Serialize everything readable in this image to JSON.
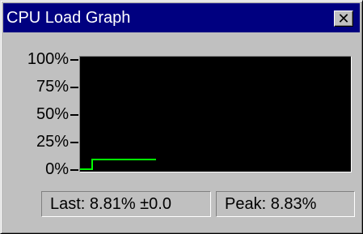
{
  "window": {
    "title": "CPU Load Graph",
    "close_label": "✕"
  },
  "graph": {
    "y_labels": [
      "100%",
      "75%",
      "50%",
      "25%",
      "0%"
    ],
    "line_color": "#00ff00",
    "background_color": "#000000",
    "samples": [
      0,
      0,
      0,
      0,
      0,
      0,
      0,
      0,
      0,
      0,
      0,
      0,
      0,
      0,
      0,
      8.81,
      8.81,
      8.81,
      8.81,
      8.81,
      8.81,
      8.81,
      8.81,
      8.81,
      8.81,
      8.81,
      8.81,
      8.81,
      8.81,
      8.81,
      8.81,
      8.81,
      8.81,
      8.81,
      8.81,
      8.81,
      8.81,
      8.81,
      8.81,
      8.81,
      8.81,
      8.81,
      8.81,
      8.81,
      8.81,
      8.81,
      8.81,
      8.81,
      8.81,
      8.81,
      8.81,
      8.81,
      8.81,
      8.81,
      8.81,
      8.81,
      8.81,
      8.81,
      8.81,
      8.81,
      8.81,
      8.81,
      8.81,
      8.81,
      8.81,
      8.81,
      8.81,
      8.81,
      8.81,
      8.81,
      8.81,
      8.81,
      8.81,
      8.81,
      8.81,
      8.81,
      8.81,
      8.81,
      8.81,
      8.81,
      8.81,
      8.81,
      8.81,
      8.81,
      8.81,
      8.81,
      8.81,
      8.81,
      8.81,
      8.81,
      8.81,
      8.81,
      8.81,
      8.81,
      8.81
    ]
  },
  "status": {
    "last_text": "Last: 8.81%  ±0.0",
    "peak_text": "Peak: 8.83%"
  }
}
